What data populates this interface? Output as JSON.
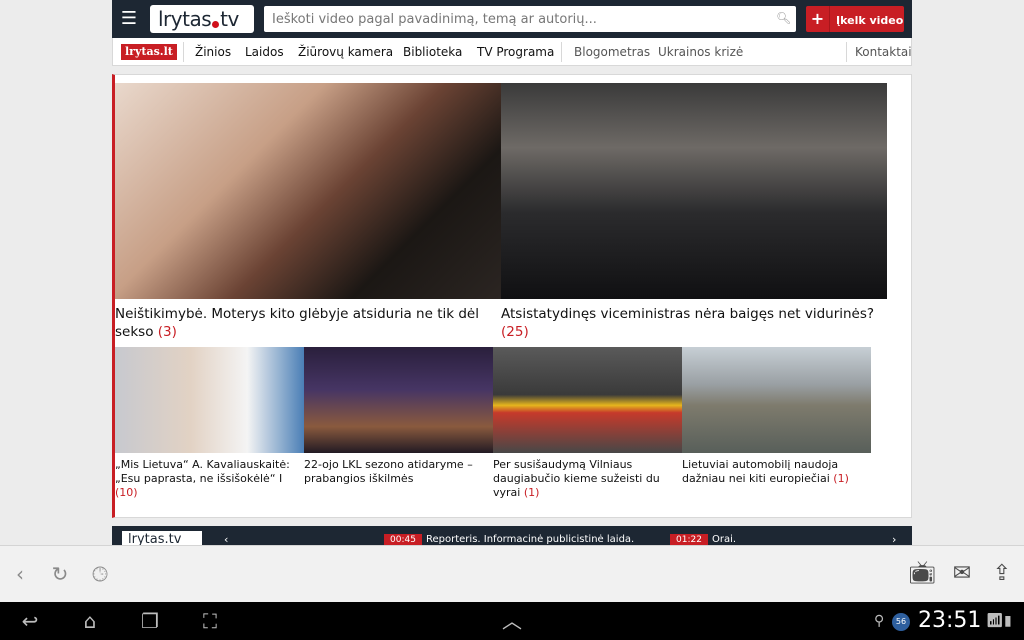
{
  "header": {
    "logo_text": "lrytas",
    "logo_suffix": "tv",
    "search_placeholder": "Ieškoti video pagal pavadinimą, temą ar autorių...",
    "upload_label": "Įkelk video",
    "plus": "+"
  },
  "nav": {
    "brand": "lrytas.lt",
    "items": [
      "Žinios",
      "Laidos",
      "Žiūrovų kamera",
      "Biblioteka",
      "TV Programa"
    ],
    "extra": [
      "Blogometras",
      "Ukrainos krizė"
    ],
    "contact": "Kontaktai"
  },
  "featured": [
    {
      "title": "Neištikimybė. Moterys kito glėbyje atsiduria ne tik dėl sekso",
      "count": "(3)"
    },
    {
      "title": "Atsistatydinęs viceministras nėra baigęs net vidurinės?",
      "count": "(25)"
    }
  ],
  "small": [
    {
      "title": "„Mis Lietuva“ A. Kavaliauskaitė: „Esu paprasta, ne išsišokėlė“ I",
      "count": "(10)"
    },
    {
      "title": "22-ojo LKL sezono atidaryme – prabangios iškilmės",
      "count": ""
    },
    {
      "title": "Per susišaudymą Vilniaus daugiabučio kieme sužeisti du vyrai",
      "count": "(1)"
    },
    {
      "title": "Lietuviai automobilį naudoja dažniau nei kiti europiečiai",
      "count": "(1)"
    }
  ],
  "tvbar": {
    "logo": "lrytas.tv",
    "programs": [
      {
        "time": "00:45",
        "title": "Reporteris. Informacinė publicistinė laida."
      },
      {
        "time": "01:22",
        "title": "Orai."
      }
    ]
  },
  "status": {
    "clock": "23:51",
    "badge": "56"
  },
  "colors": {
    "accent": "#c81e24",
    "header_bg": "#1d2733"
  }
}
